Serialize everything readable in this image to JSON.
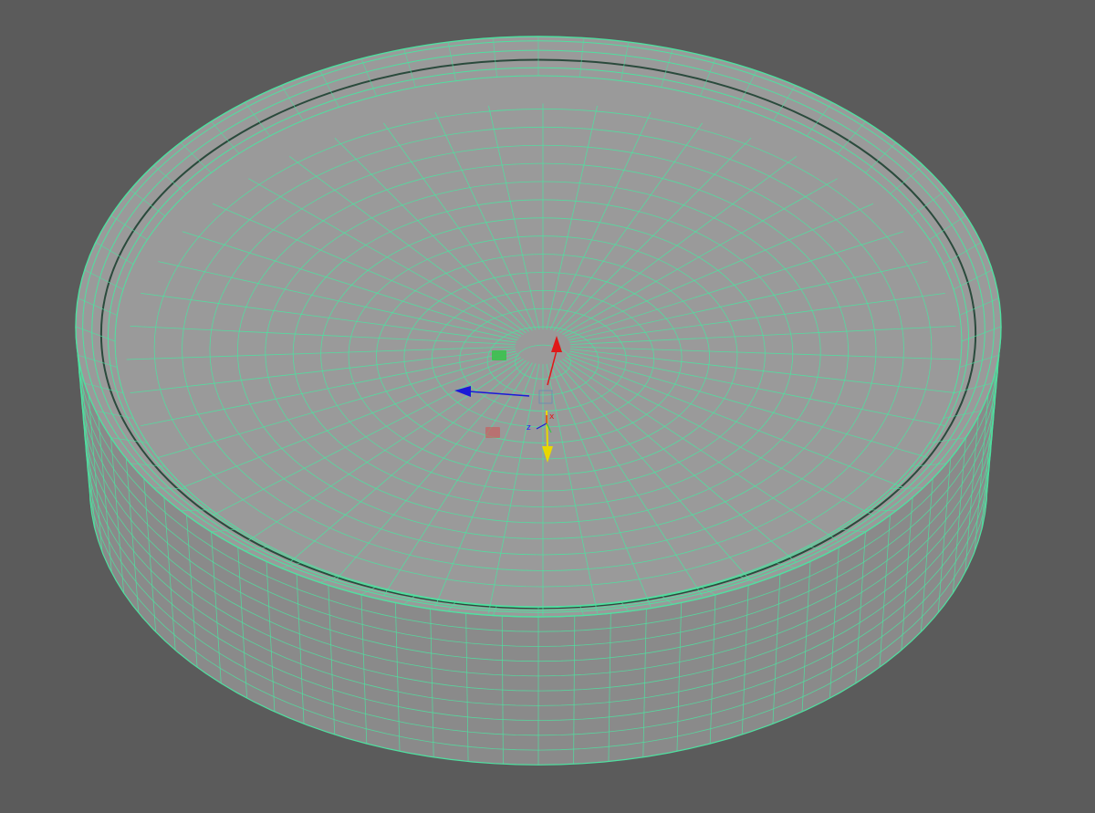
{
  "viewport": {
    "background": "#5b5b5b",
    "surface_top": "#9a9a9a",
    "surface_side": "#8a8a8a",
    "wireframe": "#4fe0a0",
    "wireframe_dark": "#3fbf85",
    "object": "cylinder-mesh"
  },
  "gizmo": {
    "type": "move-manipulator",
    "x_axis_color": "#e01818",
    "y_axis_color": "#1a1ad8",
    "z_axis_color": "#e8d800",
    "plane_handle_green": "#37c24a",
    "plane_handle_red": "#d45050",
    "labels": {
      "x": "x",
      "z": "z"
    }
  }
}
